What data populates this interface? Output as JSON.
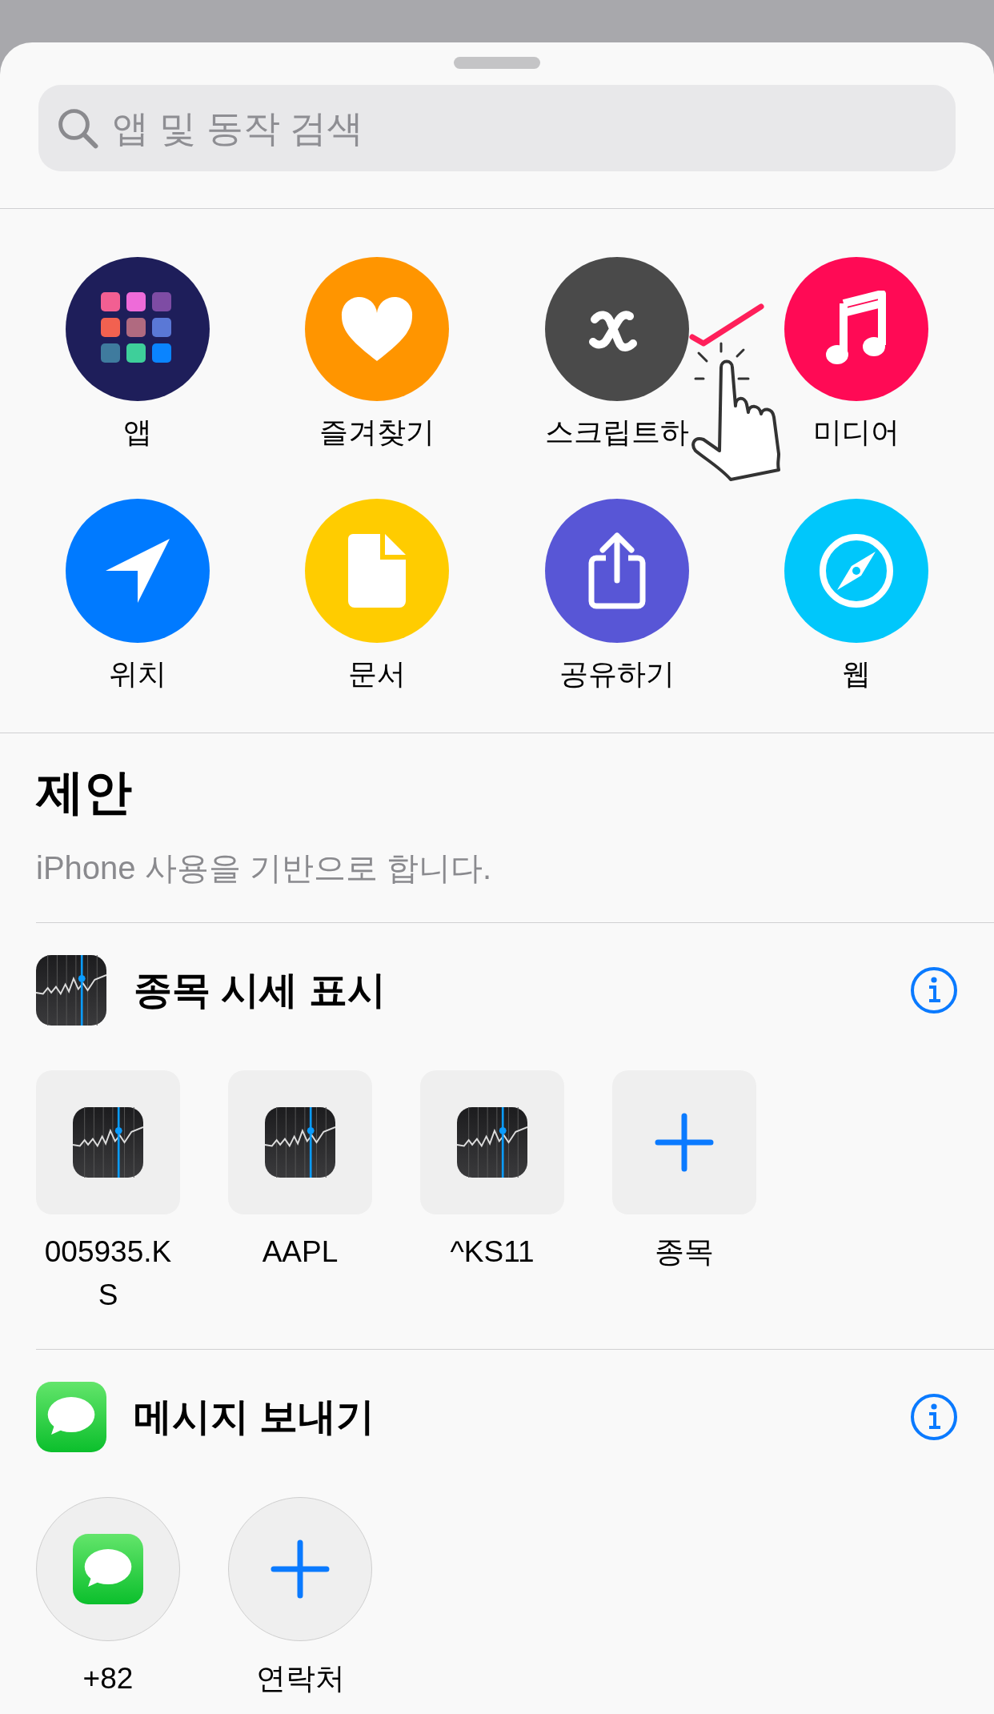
{
  "search": {
    "placeholder": "앱 및 동작 검색"
  },
  "categories": [
    {
      "label": "앱",
      "kind": "apps"
    },
    {
      "label": "즐겨찾기",
      "kind": "favorites"
    },
    {
      "label": "스크립트하",
      "kind": "scripting",
      "tap_hint": true
    },
    {
      "label": "미디어",
      "kind": "media"
    },
    {
      "label": "위치",
      "kind": "location"
    },
    {
      "label": "문서",
      "kind": "documents"
    },
    {
      "label": "공유하기",
      "kind": "sharing"
    },
    {
      "label": "웹",
      "kind": "web"
    }
  ],
  "suggestions": {
    "title": "제안",
    "subtitle": "iPhone 사용을 기반으로 합니다.",
    "actions": [
      {
        "title": "종목 시세 표시",
        "kind": "stocks",
        "items": [
          {
            "label": "005935.KS",
            "kind": "item"
          },
          {
            "label": "AAPL",
            "kind": "item"
          },
          {
            "label": "^KS11",
            "kind": "item"
          },
          {
            "label": "종목",
            "kind": "add"
          }
        ]
      },
      {
        "title": "메시지 보내기",
        "kind": "messages",
        "items": [
          {
            "label": "+82",
            "kind": "item"
          },
          {
            "label": "연락처",
            "kind": "add"
          }
        ]
      }
    ]
  }
}
